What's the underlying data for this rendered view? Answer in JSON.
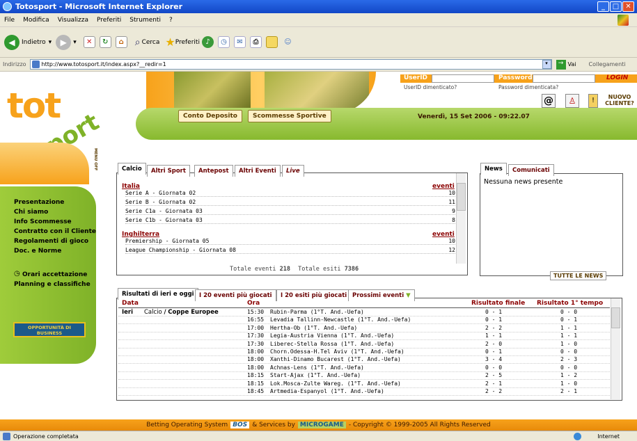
{
  "window": {
    "title": "Totosport - Microsoft Internet Explorer"
  },
  "menu": [
    "File",
    "Modifica",
    "Visualizza",
    "Preferiti",
    "Strumenti",
    "?"
  ],
  "toolbar": {
    "back": "Indietro",
    "search": "Cerca",
    "favorites": "Preferiti"
  },
  "address": {
    "label": "Indirizzo",
    "url": "http://www.totosport.it/index.aspx?__redir=1",
    "go": "Vai",
    "links": "Collegamenti"
  },
  "header": {
    "logo_top": "tot",
    "logo_bottom": "sport",
    "userid_label": "UserID",
    "password_label": "Password",
    "login": "LOGIN",
    "userid_forgot": "UserID dimenticato?",
    "password_forgot": "Password dimenticata?",
    "new_client": "NUOVO CLIENTE?",
    "btn_conto": "Conto Deposito",
    "btn_scommesse": "Scommesse Sportive",
    "date": "Venerdì, 15 Set 2006 - 09:22.07",
    "side_menu": "MENU OFF"
  },
  "sidenav": {
    "items": [
      "Presentazione",
      "Chi siamo",
      "Info Scommesse",
      "Contratto con il Cliente",
      "Regolamenti di gioco",
      "Doc. e Norme"
    ],
    "orari": "Orari accettazione",
    "planning": "Planning e classifiche",
    "banner": "OPPORTUNITÀ DI BUSINESS"
  },
  "sports": {
    "tabs": [
      "Calcio",
      "Altri Sport",
      "Antepost",
      "Altri Eventi",
      "Live"
    ],
    "groups": [
      {
        "name": "Italia",
        "events_label": "eventi",
        "rows": [
          {
            "name": "Serie A - Giornata 02",
            "count": "10"
          },
          {
            "name": "Serie B - Giornata 02",
            "count": "11"
          },
          {
            "name": "Serie C1a - Giornata 03",
            "count": "9"
          },
          {
            "name": "Serie C1b - Giornata 03",
            "count": "8"
          }
        ]
      },
      {
        "name": "Inghilterra",
        "events_label": "eventi",
        "rows": [
          {
            "name": "Premiership - Giornata 05",
            "count": "10"
          },
          {
            "name": "League Championship - Giornata 08",
            "count": "12"
          }
        ]
      }
    ],
    "totals_label1": "Totale eventi",
    "totals_value1": "218",
    "totals_label2": "Totale esiti",
    "totals_value2": "7386"
  },
  "news": {
    "tabs": [
      "News",
      "Comunicati"
    ],
    "empty": "Nessuna news presente",
    "all": "TUTTE LE NEWS"
  },
  "results": {
    "tabs": [
      "Risultati di ieri e oggi",
      "I 20 eventi più giocati",
      "I 20 esiti più giocati",
      "Prossimi eventi"
    ],
    "headers": [
      "Data",
      "Ora",
      "Risultato finale",
      "Risultato 1° tempo"
    ],
    "day": "Ieri",
    "competition_sport": "Calcio",
    "competition_sep": "/",
    "competition_name": "Coppe Europee",
    "rows": [
      {
        "time": "15:30",
        "match": "Rubin-Parma (1°T. And.-Uefa)",
        "final": "0 - 1",
        "half": "0 - 0"
      },
      {
        "time": "16:55",
        "match": "Levadia Tallinn-Newcastle (1°T. And.-Uefa)",
        "final": "0 - 1",
        "half": "0 - 1"
      },
      {
        "time": "17:00",
        "match": "Hertha-Ob (1°T. And.-Uefa)",
        "final": "2 - 2",
        "half": "1 - 1"
      },
      {
        "time": "17:30",
        "match": "Legia-Austria Vienna (1°T. And.-Uefa)",
        "final": "1 - 1",
        "half": "1 - 1"
      },
      {
        "time": "17:30",
        "match": "Liberec-Stella Rossa (1°T. And.-Uefa)",
        "final": "2 - 0",
        "half": "1 - 0"
      },
      {
        "time": "18:00",
        "match": "Chorn.Odessa-H.Tel Aviv (1°T. And.-Uefa)",
        "final": "0 - 1",
        "half": "0 - 0"
      },
      {
        "time": "18:00",
        "match": "Xanthi-Dinamo Bucarest (1°T. And.-Uefa)",
        "final": "3 - 4",
        "half": "2 - 3"
      },
      {
        "time": "18:00",
        "match": "Achnas-Lens (1°T. And.-Uefa)",
        "final": "0 - 0",
        "half": "0 - 0"
      },
      {
        "time": "18:15",
        "match": "Start-Ajax (1°T. And.-Uefa)",
        "final": "2 - 5",
        "half": "1 - 2"
      },
      {
        "time": "18:15",
        "match": "Lok.Mosca-Zulte Wareg. (1°T. And.-Uefa)",
        "final": "2 - 1",
        "half": "1 - 0"
      },
      {
        "time": "18:45",
        "match": "Artmedia-Espanyol (1°T. And.-Uefa)",
        "final": "2 - 2",
        "half": "2 - 1"
      }
    ]
  },
  "footer": {
    "text1": "Betting Operating System",
    "logo1": "BOS",
    "text2": "& Services by",
    "logo2": "MICROGAME",
    "text3": "- Copyright © 1999-2005 All Rights Reserved"
  },
  "statusbar": {
    "text": "Operazione completata",
    "zone": "Internet"
  }
}
